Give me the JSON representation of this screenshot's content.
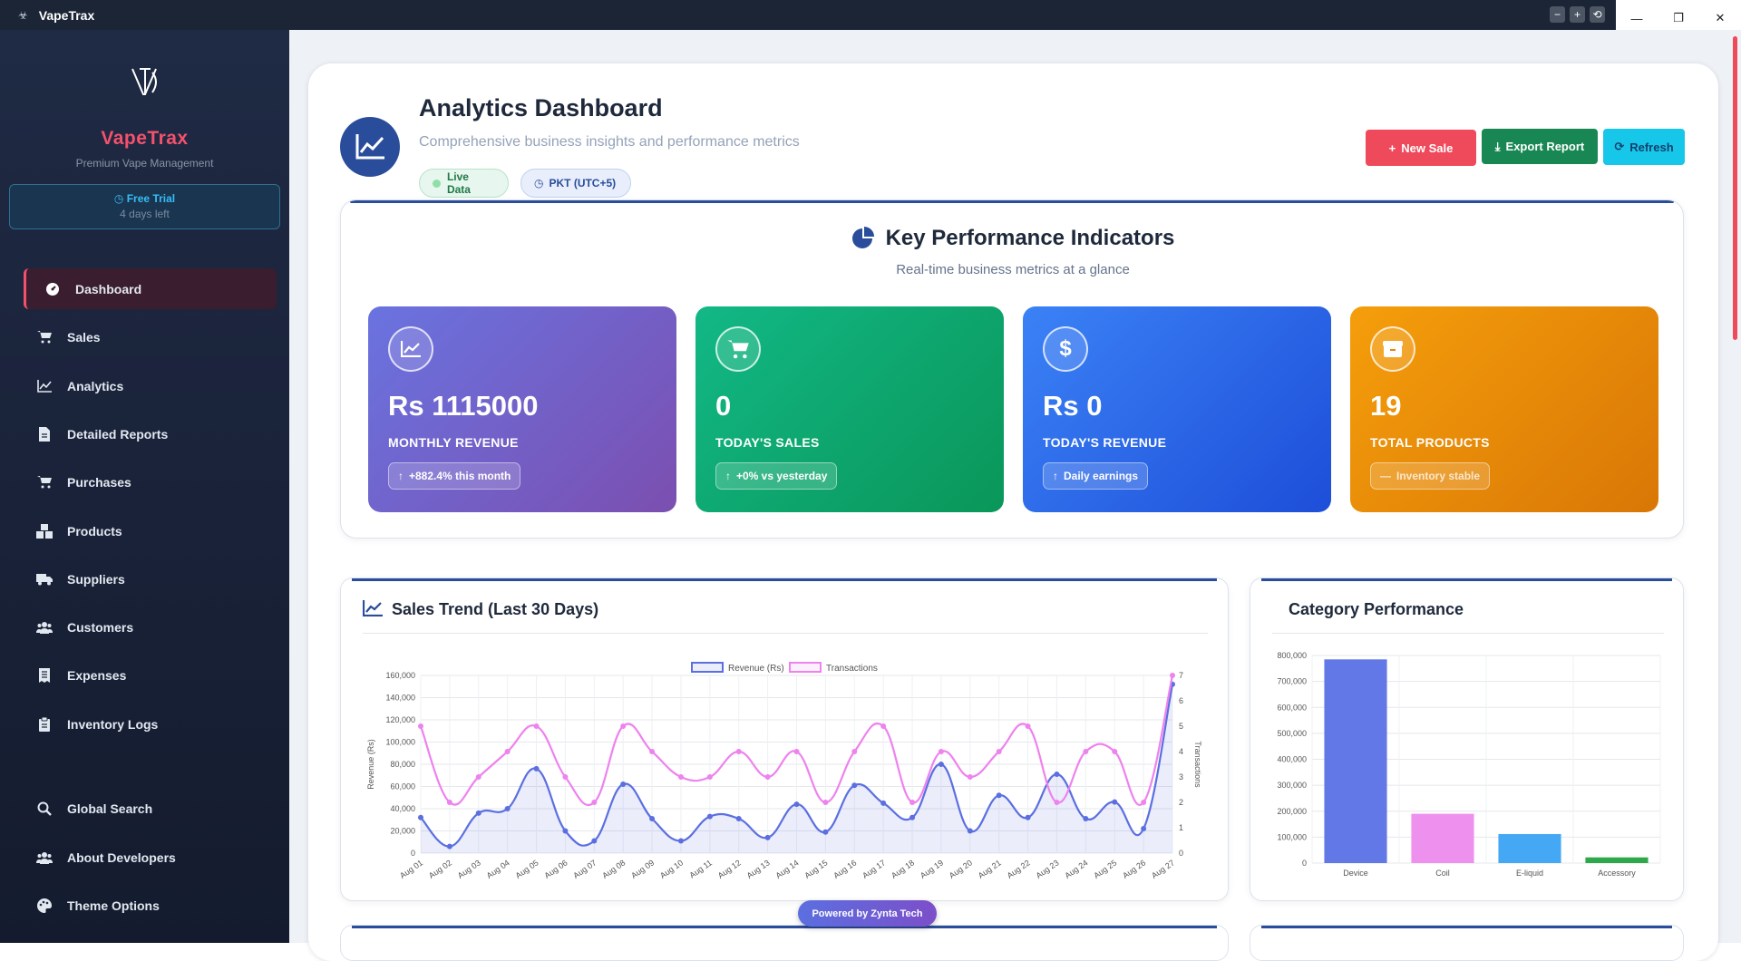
{
  "titlebar": {
    "logo": "☣",
    "app_name": "VapeTrax",
    "mini_buttons": [
      "−",
      "+",
      "⟲"
    ],
    "win_min": "—",
    "win_max": "❐",
    "win_close": "✕"
  },
  "sidebar": {
    "logo_glyph": "Ὗ",
    "brand": "VapeTrax",
    "brand_sub": "Premium Vape Management",
    "trial_title": "Free Trial",
    "trial_days": "4 days left",
    "items": [
      {
        "label": "Dashboard",
        "icon": "dashboard-icon",
        "active": true
      },
      {
        "label": "Sales",
        "icon": "cart-icon"
      },
      {
        "label": "Analytics",
        "icon": "line-chart-icon"
      },
      {
        "label": "Detailed Reports",
        "icon": "file-icon"
      },
      {
        "label": "Purchases",
        "icon": "cart-icon"
      },
      {
        "label": "Products",
        "icon": "boxes-icon"
      },
      {
        "label": "Suppliers",
        "icon": "truck-icon"
      },
      {
        "label": "Customers",
        "icon": "users-icon"
      },
      {
        "label": "Expenses",
        "icon": "receipt-icon"
      },
      {
        "label": "Inventory Logs",
        "icon": "clipboard-icon"
      },
      {
        "label": "Global Search",
        "icon": "search-icon"
      },
      {
        "label": "About Developers",
        "icon": "users-icon"
      },
      {
        "label": "Theme Options",
        "icon": "palette-icon"
      }
    ]
  },
  "header": {
    "title": "Analytics Dashboard",
    "subtitle": "Comprehensive business insights and performance metrics",
    "live_pill": "Live Data",
    "tz_pill": "PKT (UTC+5)",
    "btn_new": "New Sale",
    "btn_export": "Export Report",
    "btn_refresh": "Refresh"
  },
  "kpi": {
    "title": "Key Performance Indicators",
    "subtitle": "Real-time business metrics at a glance",
    "cards": [
      {
        "value": "Rs 1115000",
        "label": "MONTHLY REVENUE",
        "chip": "+882.4% this month",
        "chip_icon": "↑",
        "icon": "line-chart-icon",
        "color_from": "#6a73e0",
        "color_to": "#7b4fb0"
      },
      {
        "value": "0",
        "label": "TODAY'S SALES",
        "chip": "+0% vs yesterday",
        "chip_icon": "↑",
        "icon": "cart-icon",
        "color_from": "#12b886",
        "color_to": "#0a9659"
      },
      {
        "value": "Rs 0",
        "label": "TODAY'S REVENUE",
        "chip": "Daily earnings",
        "chip_icon": "↑",
        "icon": "dollar-icon",
        "color_from": "#3b82f6",
        "color_to": "#1d4ed8"
      },
      {
        "value": "19",
        "label": "TOTAL PRODUCTS",
        "chip": "Inventory stable",
        "chip_icon": "—",
        "icon": "box-icon",
        "color_from": "#f59e0b",
        "color_to": "#d97706"
      }
    ]
  },
  "sales_trend": {
    "title": "Sales Trend (Last 30 Days)"
  },
  "category": {
    "title": "Category Performance"
  },
  "powered": "Powered by Zynta Tech",
  "chart_data": [
    {
      "type": "line",
      "title": "Sales Trend (Last 30 Days)",
      "categories": [
        "Aug 01",
        "Aug 02",
        "Aug 03",
        "Aug 04",
        "Aug 05",
        "Aug 06",
        "Aug 07",
        "Aug 08",
        "Aug 09",
        "Aug 10",
        "Aug 11",
        "Aug 12",
        "Aug 13",
        "Aug 14",
        "Aug 15",
        "Aug 16",
        "Aug 17",
        "Aug 18",
        "Aug 19",
        "Aug 20",
        "Aug 21",
        "Aug 22",
        "Aug 23",
        "Aug 24",
        "Aug 25",
        "Aug 26",
        "Aug 27"
      ],
      "ylabel": "Revenue (Rs)",
      "y2label": "Transactions",
      "ylim": [
        0,
        160000
      ],
      "y2lim": [
        0,
        7
      ],
      "yticks": [
        "0",
        "20,000",
        "40,000",
        "60,000",
        "80,000",
        "100,000",
        "120,000",
        "140,000",
        "160,000"
      ],
      "y2ticks": [
        "0",
        "1",
        "2",
        "3",
        "4",
        "5",
        "6",
        "7"
      ],
      "legend_position": "top",
      "series": [
        {
          "name": "Revenue (Rs)",
          "axis": "left",
          "color": "#5b6fe0",
          "values": [
            32000,
            6000,
            36000,
            40000,
            76000,
            20000,
            11000,
            62000,
            31000,
            11000,
            33000,
            31000,
            14000,
            44000,
            19000,
            61000,
            45000,
            32000,
            80000,
            20000,
            52000,
            32000,
            71000,
            31000,
            46000,
            22000,
            152000
          ]
        },
        {
          "name": "Transactions",
          "axis": "right",
          "color": "#ee82ee",
          "values": [
            5,
            2,
            3,
            4,
            5,
            3,
            2,
            5,
            4,
            3,
            3,
            4,
            3,
            4,
            2,
            4,
            5,
            2,
            4,
            3,
            4,
            5,
            2,
            4,
            4,
            2,
            7
          ]
        }
      ]
    },
    {
      "type": "bar",
      "title": "Category Performance",
      "categories": [
        "Device",
        "Coil",
        "E-liquid",
        "Accessory"
      ],
      "values": [
        785000,
        190000,
        112000,
        22000
      ],
      "colors": [
        "#6278e6",
        "#ee90ee",
        "#45a8f5",
        "#2ea84a"
      ],
      "ylim": [
        0,
        800000
      ],
      "yticks": [
        "0",
        "100,000",
        "200,000",
        "300,000",
        "400,000",
        "500,000",
        "600,000",
        "700,000",
        "800,000"
      ]
    }
  ]
}
